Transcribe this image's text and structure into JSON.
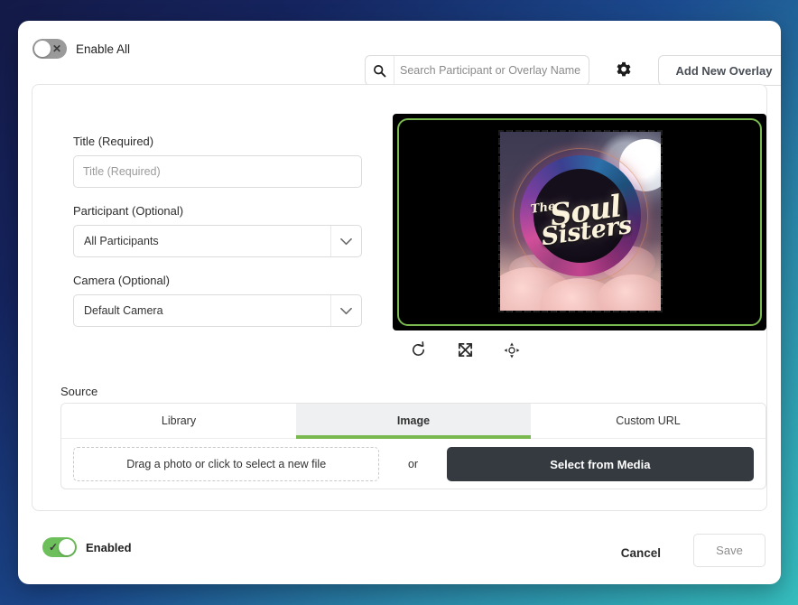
{
  "topbar": {
    "enable_all_label": "Enable All",
    "enable_all_state": "off",
    "search_placeholder": "Search Participant or Overlay Name",
    "search_value": "",
    "settings_icon": "gear-icon",
    "add_button_label": "Add New Overlay"
  },
  "form": {
    "title_label": "Title (Required)",
    "title_placeholder": "Title (Required)",
    "title_value": "",
    "participant_label": "Participant (Optional)",
    "participant_value": "All Participants",
    "camera_label": "Camera (Optional)",
    "camera_value": "Default Camera"
  },
  "preview": {
    "border_color": "#7ab94f",
    "background_color": "#000000",
    "artwork": {
      "line1": "The",
      "line2": "Soul",
      "line3": "Sisters"
    },
    "tools": [
      {
        "name": "rotate-icon",
        "label": "Rotate"
      },
      {
        "name": "expand-icon",
        "label": "Expand"
      },
      {
        "name": "reposition-icon",
        "label": "Reposition"
      }
    ]
  },
  "source": {
    "label": "Source",
    "tabs": [
      {
        "label": "Library",
        "active": false
      },
      {
        "label": "Image",
        "active": true
      },
      {
        "label": "Custom URL",
        "active": false
      }
    ],
    "dropzone_text": "Drag a photo or click to select a new file",
    "or_text": "or",
    "media_button_label": "Select from Media",
    "active_underline_color": "#7ab94f"
  },
  "footer": {
    "enabled_label": "Enabled",
    "enabled_state": "on",
    "cancel_label": "Cancel",
    "save_label": "Save"
  },
  "colors": {
    "accent_green": "#7ab94f",
    "toggle_on": "#6cbf5a",
    "toggle_off": "#9a9a9a",
    "dark_button": "#343a40"
  }
}
